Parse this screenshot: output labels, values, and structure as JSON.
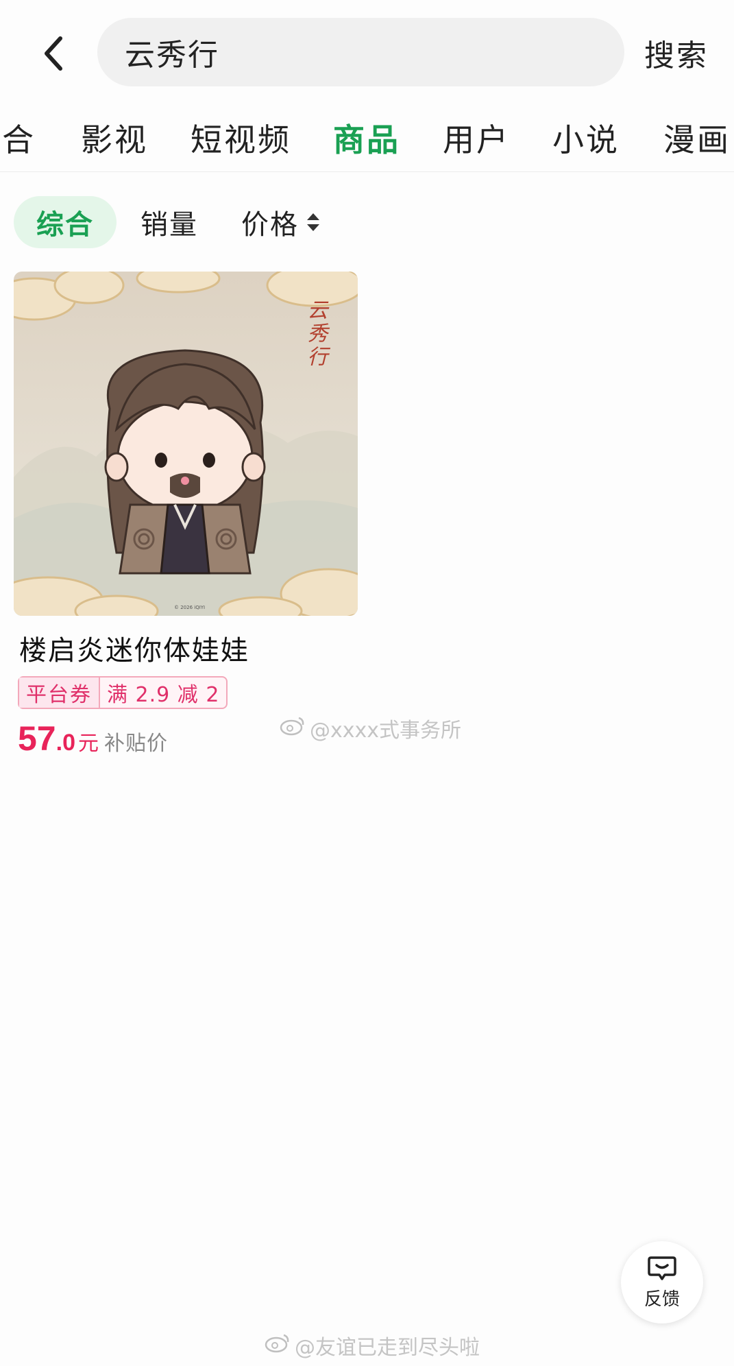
{
  "search": {
    "query": "云秀行",
    "button_label": "搜索"
  },
  "tabs": [
    {
      "label": "综合"
    },
    {
      "label": "影视"
    },
    {
      "label": "短视频"
    },
    {
      "label": "商品",
      "active": true
    },
    {
      "label": "用户"
    },
    {
      "label": "小说"
    },
    {
      "label": "漫画"
    }
  ],
  "filters": {
    "comprehensive": "综合",
    "sales": "销量",
    "price": "价格"
  },
  "product": {
    "title": "楼启炎迷你体娃娃",
    "image_logo": "云秀行",
    "image_copyright": "© 2026 iQIYI",
    "coupon_type": "平台券",
    "coupon_rule": "满 2.9 减 2",
    "price_int": "57",
    "price_dec": ".0",
    "price_unit": "元",
    "price_note": "补贴价"
  },
  "watermarks": {
    "top": "@xxxx式事务所",
    "bottom": "@友谊已走到尽头啦"
  },
  "feedback": {
    "label": "反馈"
  },
  "colors": {
    "accent_green": "#1aa053",
    "price_red": "#e8245a",
    "coupon_pink": "#e0306a"
  }
}
